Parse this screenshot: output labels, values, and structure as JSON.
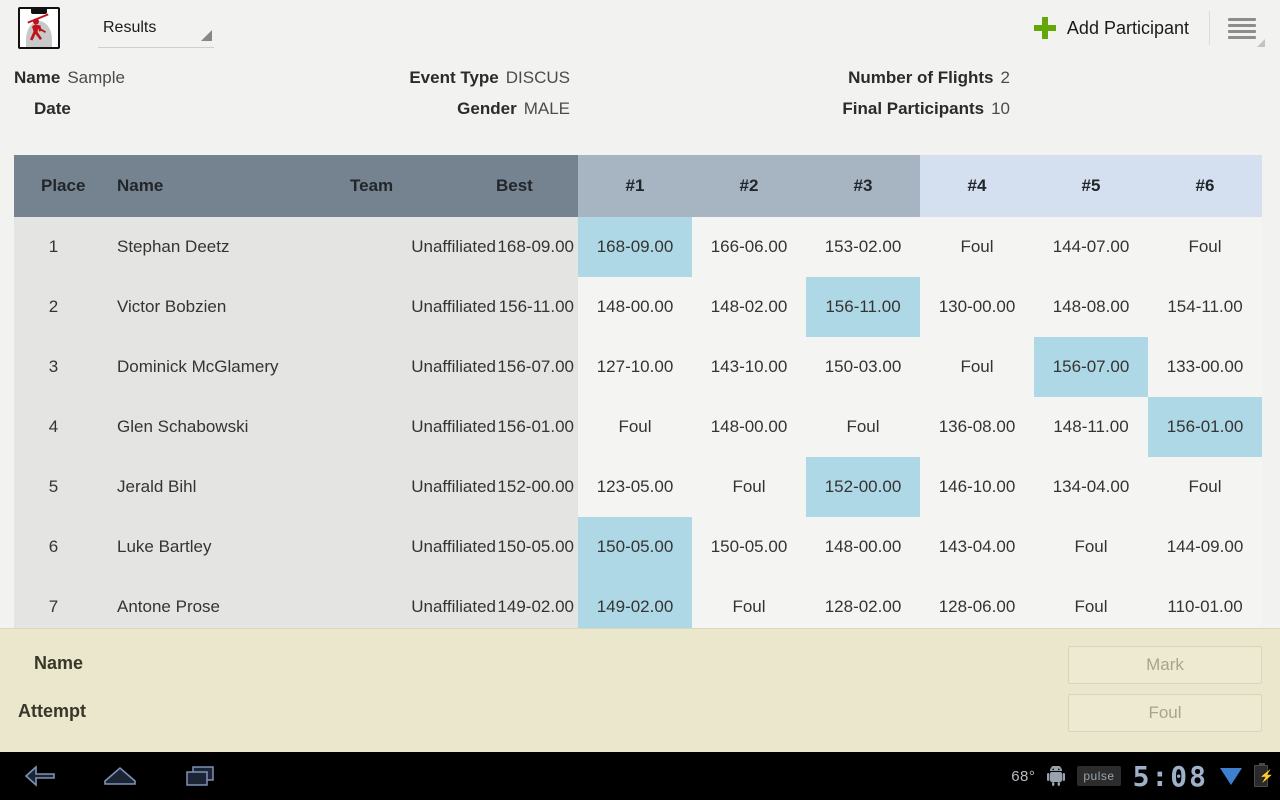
{
  "toolbar": {
    "app_icon": "javelin-thrower-clipboard-icon",
    "spinner_value": "Results",
    "add_participant_label": "Add Participant",
    "plus_icon": "plus-icon",
    "plus_color": "#64a70b",
    "overflow_icon": "overflow-menu-icon"
  },
  "meta": {
    "name_label": "Name",
    "name_value": "Sample",
    "date_label": "Date",
    "date_value": "",
    "event_type_label": "Event Type",
    "event_type_value": "DISCUS",
    "gender_label": "Gender",
    "gender_value": "MALE",
    "flights_label": "Number of Flights",
    "flights_value": "2",
    "final_participants_label": "Final Participants",
    "final_participants_value": "10"
  },
  "table": {
    "headers": {
      "place": "Place",
      "name": "Name",
      "team": "Team",
      "best": "Best",
      "attempts": [
        "#1",
        "#2",
        "#3",
        "#4",
        "#5",
        "#6"
      ]
    },
    "colors": {
      "header_fixed": "#75828f",
      "header_flight1": "#a7b4c2",
      "header_flight2": "#d4e0ef",
      "row_fixed": "#e4e4e2",
      "row_attempts": "#f4f4f2",
      "highlight": "#aed8e6"
    },
    "rows": [
      {
        "place": "1",
        "name": "Stephan Deetz",
        "team": "Unaffiliated",
        "best": "168-09.00",
        "attempts": [
          "168-09.00",
          "166-06.00",
          "153-02.00",
          "Foul",
          "144-07.00",
          "Foul"
        ],
        "best_index": 0
      },
      {
        "place": "2",
        "name": "Victor Bobzien",
        "team": "Unaffiliated",
        "best": "156-11.00",
        "attempts": [
          "148-00.00",
          "148-02.00",
          "156-11.00",
          "130-00.00",
          "148-08.00",
          "154-11.00"
        ],
        "best_index": 2
      },
      {
        "place": "3",
        "name": "Dominick McGlamery",
        "team": "Unaffiliated",
        "best": "156-07.00",
        "attempts": [
          "127-10.00",
          "143-10.00",
          "150-03.00",
          "Foul",
          "156-07.00",
          "133-00.00"
        ],
        "best_index": 4
      },
      {
        "place": "4",
        "name": "Glen Schabowski",
        "team": "Unaffiliated",
        "best": "156-01.00",
        "attempts": [
          "Foul",
          "148-00.00",
          "Foul",
          "136-08.00",
          "148-11.00",
          "156-01.00"
        ],
        "best_index": 5
      },
      {
        "place": "5",
        "name": "Jerald Bihl",
        "team": "Unaffiliated",
        "best": "152-00.00",
        "attempts": [
          "123-05.00",
          "Foul",
          "152-00.00",
          "146-10.00",
          "134-04.00",
          "Foul"
        ],
        "best_index": 2
      },
      {
        "place": "6",
        "name": "Luke Bartley",
        "team": "Unaffiliated",
        "best": "150-05.00",
        "attempts": [
          "150-05.00",
          "150-05.00",
          "148-00.00",
          "143-04.00",
          "Foul",
          "144-09.00"
        ],
        "best_index": 0
      },
      {
        "place": "7",
        "name": "Antone Prose",
        "team": "Unaffiliated",
        "best": "149-02.00",
        "attempts": [
          "149-02.00",
          "Foul",
          "128-02.00",
          "128-06.00",
          "Foul",
          "110-01.00"
        ],
        "best_index": 0
      }
    ]
  },
  "entry_panel": {
    "name_label": "Name",
    "name_value": "",
    "attempt_label": "Attempt",
    "attempt_value": "",
    "mark_button": "Mark",
    "foul_button": "Foul"
  },
  "system_bar": {
    "back_icon": "back-arrow-icon",
    "home_icon": "home-icon",
    "recents_icon": "recent-apps-icon",
    "temperature": "68°",
    "android_icon": "android-robot-icon",
    "pulse_badge": "pulse",
    "clock": "5:08",
    "signal_icon": "signal-triangle-icon",
    "battery_icon": "battery-charging-icon"
  }
}
